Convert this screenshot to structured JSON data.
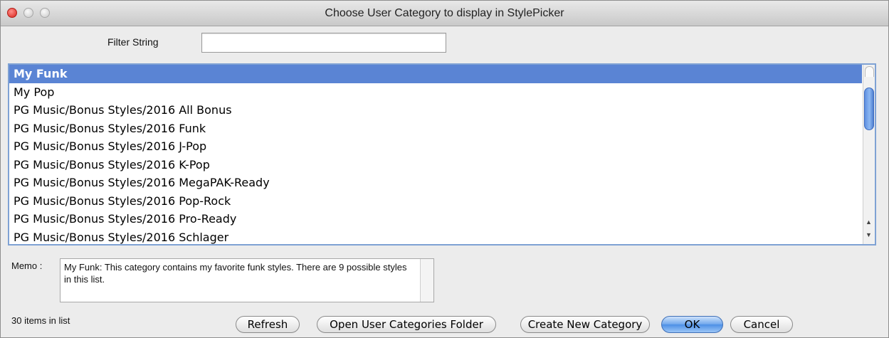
{
  "window": {
    "title": "Choose User Category to display in StylePicker"
  },
  "filter": {
    "label": "Filter String",
    "value": "",
    "placeholder": ""
  },
  "list": {
    "selected_index": 0,
    "items": [
      {
        "label": "My Funk"
      },
      {
        "label": "My Pop"
      },
      {
        "label": "PG Music/Bonus Styles/2016 All Bonus"
      },
      {
        "label": "PG Music/Bonus Styles/2016 Funk"
      },
      {
        "label": "PG Music/Bonus Styles/2016 J-Pop"
      },
      {
        "label": "PG Music/Bonus Styles/2016 K-Pop"
      },
      {
        "label": "PG Music/Bonus Styles/2016 MegaPAK-Ready"
      },
      {
        "label": "PG Music/Bonus Styles/2016 Pop-Rock"
      },
      {
        "label": "PG Music/Bonus Styles/2016 Pro-Ready"
      },
      {
        "label": "PG Music/Bonus Styles/2016 Schlager"
      }
    ],
    "scroll_up_glyph": "▲",
    "scroll_down_glyph": "▼"
  },
  "memo": {
    "label": "Memo :",
    "text": "My Funk: This category contains my favorite funk styles. There are 9 possible styles in this list."
  },
  "footer": {
    "count_text": "30 items in list",
    "refresh_label": "Refresh",
    "open_folder_label": "Open User Categories Folder",
    "create_label": "Create New Category",
    "ok_label": "OK",
    "cancel_label": "Cancel"
  },
  "colors": {
    "selection": "#5a84d4",
    "close_button": "#d9241c",
    "default_button": "#4d8fe6"
  }
}
